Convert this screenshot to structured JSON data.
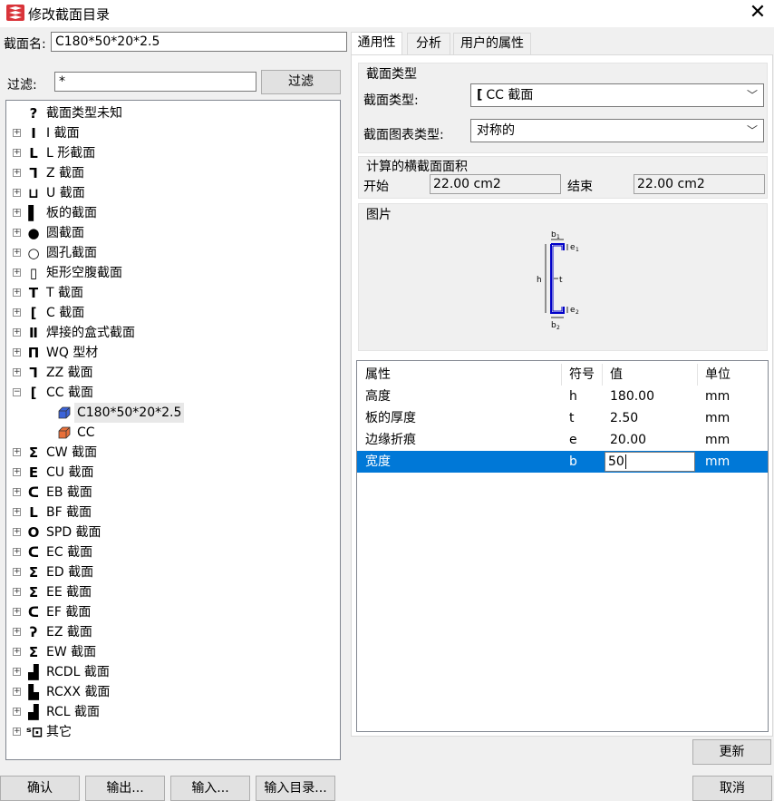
{
  "window": {
    "title": "修改截面目录",
    "close_glyph": "✕"
  },
  "section_name": {
    "label": "截面名:",
    "value": "C180*50*20*2.5"
  },
  "filter": {
    "label": "过滤:",
    "value": "*",
    "button": "过滤"
  },
  "tree": {
    "items": [
      {
        "label": "截面类型未知",
        "icon": "question-icon",
        "glyph": "?",
        "expander": ""
      },
      {
        "label": "I 截面",
        "icon": "i-beam-icon",
        "glyph": "I",
        "expander": "+"
      },
      {
        "label": "L 形截面",
        "icon": "l-section-icon",
        "glyph": "L",
        "expander": "+"
      },
      {
        "label": "Z 截面",
        "icon": "z-section-icon",
        "glyph": "Ꞁ",
        "expander": "+"
      },
      {
        "label": "U 截面",
        "icon": "u-section-icon",
        "glyph": "⊔",
        "expander": "+"
      },
      {
        "label": "板的截面",
        "icon": "plate-icon",
        "glyph": "▌",
        "expander": "+"
      },
      {
        "label": "圆截面",
        "icon": "round-icon",
        "glyph": "●",
        "expander": "+"
      },
      {
        "label": "圆孔截面",
        "icon": "tube-icon",
        "glyph": "○",
        "expander": "+"
      },
      {
        "label": "矩形空腹截面",
        "icon": "rect-hollow-icon",
        "glyph": "▯",
        "expander": "+"
      },
      {
        "label": "T 截面",
        "icon": "t-section-icon",
        "glyph": "T",
        "expander": "+"
      },
      {
        "label": "C 截面",
        "icon": "c-section-icon",
        "glyph": "[",
        "expander": "+"
      },
      {
        "label": "焊接的盒式截面",
        "icon": "box-welded-icon",
        "glyph": "Ⅱ",
        "expander": "+"
      },
      {
        "label": "WQ 型材",
        "icon": "wq-section-icon",
        "glyph": "Π",
        "expander": "+"
      },
      {
        "label": "ZZ 截面",
        "icon": "zz-section-icon",
        "glyph": "Ꞁ",
        "expander": "+"
      },
      {
        "label": "CC 截面",
        "icon": "cc-section-icon",
        "glyph": "[",
        "expander": "−"
      },
      {
        "label": "C180*50*20*2.5",
        "icon": "profile-blue-icon",
        "glyph": "",
        "expander": "",
        "child": true,
        "selected": true
      },
      {
        "label": "CC",
        "icon": "profile-orange-icon",
        "glyph": "",
        "expander": "",
        "child": true
      },
      {
        "label": "CW 截面",
        "icon": "cw-section-icon",
        "glyph": "Σ",
        "expander": "+"
      },
      {
        "label": "CU 截面",
        "icon": "cu-section-icon",
        "glyph": "E",
        "expander": "+"
      },
      {
        "label": "EB 截面",
        "icon": "eb-section-icon",
        "glyph": "ᑕ",
        "expander": "+"
      },
      {
        "label": "BF 截面",
        "icon": "bf-section-icon",
        "glyph": "L",
        "expander": "+"
      },
      {
        "label": "SPD 截面",
        "icon": "spd-section-icon",
        "glyph": "O",
        "expander": "+"
      },
      {
        "label": "EC 截面",
        "icon": "ec-section-icon",
        "glyph": "ᑕ",
        "expander": "+"
      },
      {
        "label": "ED 截面",
        "icon": "ed-section-icon",
        "glyph": "Σ",
        "expander": "+"
      },
      {
        "label": "EE 截面",
        "icon": "ee-section-icon",
        "glyph": "Σ",
        "expander": "+"
      },
      {
        "label": "EF 截面",
        "icon": "ef-section-icon",
        "glyph": "ᑕ",
        "expander": "+"
      },
      {
        "label": "EZ 截面",
        "icon": "ez-section-icon",
        "glyph": "ʔ",
        "expander": "+"
      },
      {
        "label": "EW 截面",
        "icon": "ew-section-icon",
        "glyph": "Σ",
        "expander": "+"
      },
      {
        "label": "RCDL 截面",
        "icon": "rcdl-section-icon",
        "glyph": "▟",
        "expander": "+"
      },
      {
        "label": "RCXX 截面",
        "icon": "rcxx-section-icon",
        "glyph": "▙",
        "expander": "+"
      },
      {
        "label": "RCL 截面",
        "icon": "rcl-section-icon",
        "glyph": "▟",
        "expander": "+"
      },
      {
        "label": "其它",
        "icon": "other-section-icon",
        "glyph": "ˢ⊡",
        "expander": "+"
      }
    ]
  },
  "tabs": [
    {
      "label": "通用性",
      "active": true
    },
    {
      "label": "分析",
      "active": false
    },
    {
      "label": "用户的属性",
      "active": false
    }
  ],
  "section_type_group": {
    "title": "截面类型",
    "type_label": "截面类型:",
    "type_value": "CC 截面",
    "chart_type_label": "截面图表类型:",
    "chart_type_value": "对称的"
  },
  "area_group": {
    "title": "计算的横截面面积",
    "start_label": "开始",
    "start_value": "22.00 cm2",
    "end_label": "结束",
    "end_value": "22.00 cm2"
  },
  "picture_group": {
    "title": "图片",
    "labels": {
      "b1": "b",
      "b1_sub": "1",
      "e1": "e",
      "e1_sub": "1",
      "h": "h",
      "t": "t",
      "e2": "e",
      "e2_sub": "2",
      "b2": "b",
      "b2_sub": "2"
    }
  },
  "properties": {
    "headers": [
      "属性",
      "符号",
      "值",
      "单位"
    ],
    "rows": [
      {
        "name": "高度",
        "symbol": "h",
        "value": "180.00",
        "unit": "mm"
      },
      {
        "name": "板的厚度",
        "symbol": "t",
        "value": "2.50",
        "unit": "mm"
      },
      {
        "name": "边缘折痕",
        "symbol": "e",
        "value": "20.00",
        "unit": "mm"
      },
      {
        "name": "宽度",
        "symbol": "b",
        "value": "50",
        "unit": "mm",
        "selected": true
      }
    ]
  },
  "buttons": {
    "update": "更新",
    "ok": "确认",
    "export": "输出...",
    "import": "输入...",
    "import_catalog": "输入目录...",
    "cancel": "取消"
  },
  "colors": {
    "selection": "#0078d7",
    "window_bg": "#f0f0f0"
  }
}
